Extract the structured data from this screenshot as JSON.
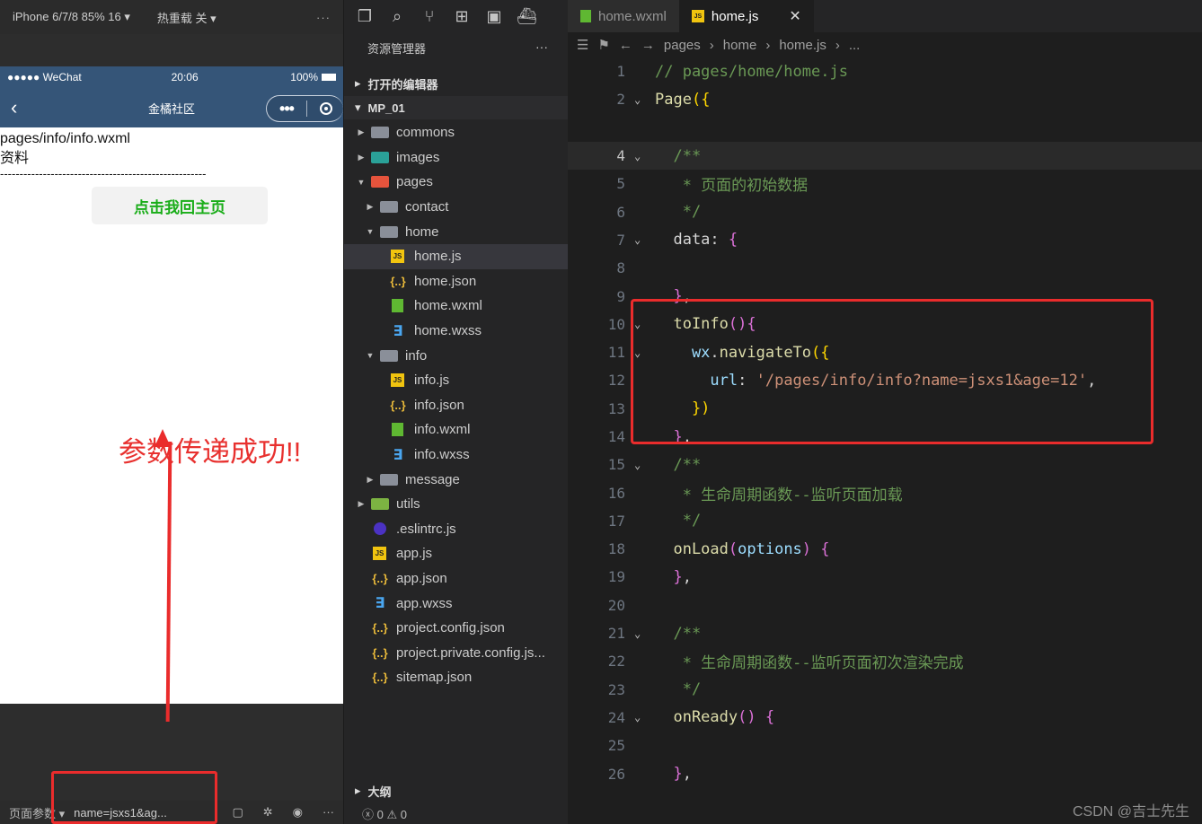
{
  "simulator": {
    "device_label": "iPhone 6/7/8 85% 16 ▾",
    "hot_reload_label": "热重载 关 ▾",
    "more": "···",
    "status": {
      "carrier": "●●●●● WeChat",
      "time": "20:06",
      "battery": "100%"
    },
    "nav_title": "金橘社区",
    "page_path": "pages/info/info.wxml",
    "page_text": "资料",
    "divider": "-----------------------------------------------------",
    "home_button": "点击我回主页",
    "success_note": "参数传递成功!!",
    "bottom": {
      "params_label": "页面参数 ▾",
      "params_value": "name=jsxs1&ag..."
    }
  },
  "explorer": {
    "title": "资源管理器",
    "more": "···",
    "open_editors": "打开的编辑器",
    "project": "MP_01",
    "tree": [
      {
        "label": "commons",
        "depth": 1,
        "type": "folder",
        "chev": "▶"
      },
      {
        "label": "images",
        "depth": 1,
        "type": "folder-img",
        "chev": "▶"
      },
      {
        "label": "pages",
        "depth": 1,
        "type": "folder-pages",
        "chev": "▼"
      },
      {
        "label": "contact",
        "depth": 2,
        "type": "folder",
        "chev": "▶"
      },
      {
        "label": "home",
        "depth": 2,
        "type": "folder",
        "chev": "▼"
      },
      {
        "label": "home.js",
        "depth": 3,
        "type": "js",
        "chev": "",
        "selected": true
      },
      {
        "label": "home.json",
        "depth": 3,
        "type": "json",
        "chev": ""
      },
      {
        "label": "home.wxml",
        "depth": 3,
        "type": "wxml",
        "chev": ""
      },
      {
        "label": "home.wxss",
        "depth": 3,
        "type": "wxss",
        "chev": ""
      },
      {
        "label": "info",
        "depth": 2,
        "type": "folder",
        "chev": "▼"
      },
      {
        "label": "info.js",
        "depth": 3,
        "type": "js",
        "chev": ""
      },
      {
        "label": "info.json",
        "depth": 3,
        "type": "json",
        "chev": ""
      },
      {
        "label": "info.wxml",
        "depth": 3,
        "type": "wxml",
        "chev": ""
      },
      {
        "label": "info.wxss",
        "depth": 3,
        "type": "wxss",
        "chev": ""
      },
      {
        "label": "message",
        "depth": 2,
        "type": "folder",
        "chev": "▶"
      },
      {
        "label": "utils",
        "depth": 1,
        "type": "folder-utils",
        "chev": "▶"
      },
      {
        "label": ".eslintrc.js",
        "depth": 1,
        "type": "eslint",
        "chev": ""
      },
      {
        "label": "app.js",
        "depth": 1,
        "type": "js",
        "chev": ""
      },
      {
        "label": "app.json",
        "depth": 1,
        "type": "json",
        "chev": ""
      },
      {
        "label": "app.wxss",
        "depth": 1,
        "type": "wxss",
        "chev": ""
      },
      {
        "label": "project.config.json",
        "depth": 1,
        "type": "json",
        "chev": ""
      },
      {
        "label": "project.private.config.js...",
        "depth": 1,
        "type": "json",
        "chev": ""
      },
      {
        "label": "sitemap.json",
        "depth": 1,
        "type": "json",
        "chev": ""
      }
    ],
    "outline": "大纲",
    "problems": "ⓧ 0 ⚠ 0"
  },
  "editor": {
    "tabs": [
      {
        "label": "home.wxml",
        "active": false,
        "icon": "wxml-icon"
      },
      {
        "label": "home.js",
        "active": true,
        "icon": "js-icon"
      }
    ],
    "breadcrumb": [
      "pages",
      "home",
      "home.js",
      "..."
    ],
    "lines": [
      {
        "n": "1",
        "fold": "",
        "segs": [
          [
            "c-com",
            "// pages/home/home.js"
          ]
        ]
      },
      {
        "n": "2",
        "fold": "⌄",
        "segs": [
          [
            "c-fn",
            "Page"
          ],
          [
            "c-brk",
            "({"
          ]
        ]
      },
      {
        "n": "",
        "fold": "",
        "segs": []
      },
      {
        "n": "4",
        "fold": "⌄",
        "cur": true,
        "hl": true,
        "segs": [
          [
            "c-com",
            "  /**"
          ]
        ]
      },
      {
        "n": "5",
        "fold": "",
        "segs": [
          [
            "c-com",
            "   * 页面的初始数据"
          ]
        ]
      },
      {
        "n": "6",
        "fold": "",
        "segs": [
          [
            "c-com",
            "   */"
          ]
        ]
      },
      {
        "n": "7",
        "fold": "⌄",
        "segs": [
          [
            "c-pl",
            "  data: "
          ],
          [
            "c-par",
            "{"
          ]
        ]
      },
      {
        "n": "8",
        "fold": "",
        "segs": []
      },
      {
        "n": "9",
        "fold": "",
        "segs": [
          [
            "c-par",
            "  }"
          ],
          [
            "c-pl",
            ","
          ]
        ]
      },
      {
        "n": "10",
        "fold": "⌄",
        "segs": [
          [
            "c-fn",
            "  toInfo"
          ],
          [
            "c-par",
            "()"
          ],
          [
            "c-par",
            "{"
          ]
        ]
      },
      {
        "n": "11",
        "fold": "⌄",
        "segs": [
          [
            "c-var",
            "    wx"
          ],
          [
            "c-pl",
            "."
          ],
          [
            "c-fn",
            "navigateTo"
          ],
          [
            "c-brk",
            "({"
          ]
        ]
      },
      {
        "n": "12",
        "fold": "",
        "segs": [
          [
            "c-key",
            "      url"
          ],
          [
            "c-pl",
            ": "
          ],
          [
            "c-str",
            "'/pages/info/info?name=jsxs1&age=12'"
          ],
          [
            "c-pl",
            ","
          ]
        ]
      },
      {
        "n": "13",
        "fold": "",
        "segs": [
          [
            "c-brk",
            "    })"
          ]
        ]
      },
      {
        "n": "14",
        "fold": "",
        "segs": [
          [
            "c-par",
            "  }"
          ],
          [
            "c-pl",
            ","
          ]
        ]
      },
      {
        "n": "15",
        "fold": "⌄",
        "segs": [
          [
            "c-com",
            "  /**"
          ]
        ]
      },
      {
        "n": "16",
        "fold": "",
        "segs": [
          [
            "c-com",
            "   * 生命周期函数--监听页面加载"
          ]
        ]
      },
      {
        "n": "17",
        "fold": "",
        "segs": [
          [
            "c-com",
            "   */"
          ]
        ]
      },
      {
        "n": "18",
        "fold": "",
        "segs": [
          [
            "c-fn",
            "  onLoad"
          ],
          [
            "c-par",
            "("
          ],
          [
            "c-var",
            "options"
          ],
          [
            "c-par",
            ")"
          ],
          [
            "c-pl",
            " "
          ],
          [
            "c-par",
            "{"
          ]
        ]
      },
      {
        "n": "19",
        "fold": "",
        "segs": [
          [
            "c-par",
            "  }"
          ],
          [
            "c-pl",
            ","
          ]
        ]
      },
      {
        "n": "20",
        "fold": "",
        "segs": []
      },
      {
        "n": "21",
        "fold": "⌄",
        "segs": [
          [
            "c-com",
            "  /**"
          ]
        ]
      },
      {
        "n": "22",
        "fold": "",
        "segs": [
          [
            "c-com",
            "   * 生命周期函数--监听页面初次渲染完成"
          ]
        ]
      },
      {
        "n": "23",
        "fold": "",
        "segs": [
          [
            "c-com",
            "   */"
          ]
        ]
      },
      {
        "n": "24",
        "fold": "⌄",
        "segs": [
          [
            "c-fn",
            "  onReady"
          ],
          [
            "c-par",
            "()"
          ],
          [
            "c-pl",
            " "
          ],
          [
            "c-par",
            "{"
          ]
        ]
      },
      {
        "n": "25",
        "fold": "",
        "segs": []
      },
      {
        "n": "26",
        "fold": "",
        "segs": [
          [
            "c-par",
            "  }"
          ],
          [
            "c-pl",
            ","
          ]
        ]
      }
    ],
    "watermark": "CSDN @吉士先生"
  }
}
